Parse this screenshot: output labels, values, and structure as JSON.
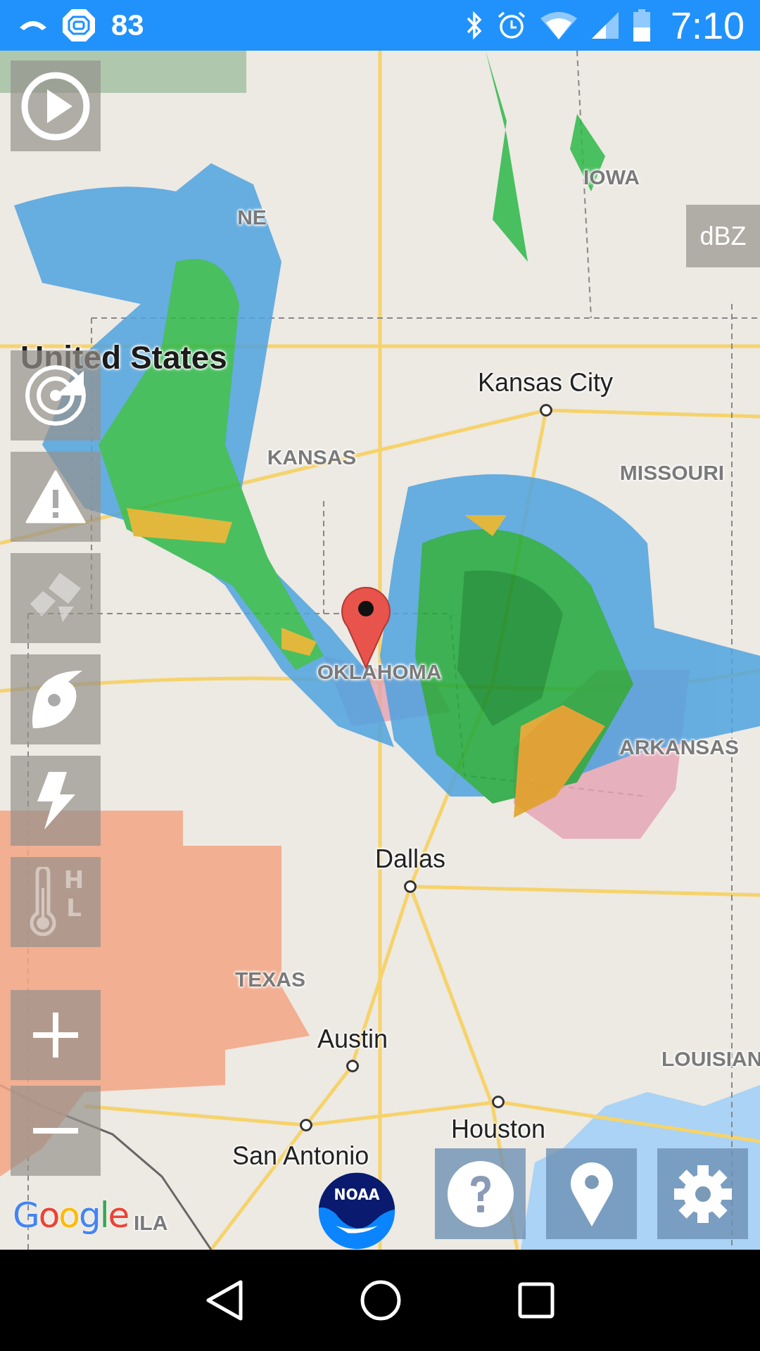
{
  "status_bar": {
    "notification_count": "83",
    "time": "7:10"
  },
  "map": {
    "labels": [
      {
        "text": "IOWA",
        "kind": "state"
      },
      {
        "text": "NE",
        "kind": "state"
      },
      {
        "text": "Kansas City",
        "kind": "city"
      },
      {
        "text": "United States",
        "kind": "country"
      },
      {
        "text": "KANSAS",
        "kind": "state"
      },
      {
        "text": "MISSOURI",
        "kind": "state"
      },
      {
        "text": "OKLAHOMA",
        "kind": "state"
      },
      {
        "text": "ARKANSAS",
        "kind": "state"
      },
      {
        "text": "Dallas",
        "kind": "city"
      },
      {
        "text": "TEXAS",
        "kind": "state"
      },
      {
        "text": "Austin",
        "kind": "city"
      },
      {
        "text": "LOUISIAN",
        "kind": "state"
      },
      {
        "text": "Houston",
        "kind": "city"
      },
      {
        "text": "San Antonio",
        "kind": "city"
      },
      {
        "text": "ILA",
        "kind": "state"
      }
    ],
    "legend_button": "dBZ",
    "google_logo": [
      "G",
      "o",
      "o",
      "g",
      "l",
      "e"
    ],
    "noaa_logo": "NOAA"
  },
  "layers": [
    {
      "kind": "radar",
      "on": true
    },
    {
      "kind": "warnings",
      "on": true
    },
    {
      "kind": "satellite",
      "on": false
    },
    {
      "kind": "hurricane",
      "on": true
    },
    {
      "kind": "lightning",
      "on": true
    },
    {
      "kind": "temperature",
      "on": false,
      "letters": [
        "H",
        "L"
      ]
    }
  ],
  "bottom_buttons": [
    {
      "kind": "help"
    },
    {
      "kind": "location"
    },
    {
      "kind": "settings"
    }
  ]
}
